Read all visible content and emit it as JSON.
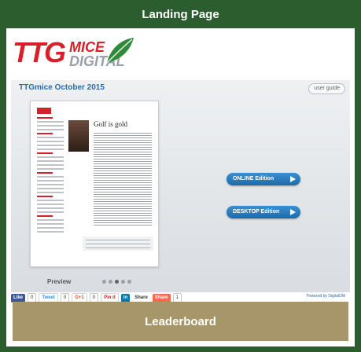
{
  "header": {
    "title": "Landing Page"
  },
  "logo": {
    "ttg": "TTG",
    "mice": "MICE",
    "digital": "DIGITAL"
  },
  "viewer": {
    "title": "TTGmice October 2015",
    "user_guide": "user guide",
    "page": {
      "headline": "Golf is gold"
    },
    "buttons": {
      "online": "ONLINE Edition",
      "desktop": "DESKTOP Edition"
    },
    "preview_label": "Preview",
    "dots_active_index": 2
  },
  "share_bar": {
    "like": "Like",
    "like_count": "0",
    "tweet": "Tweet",
    "tweet_count": "0",
    "gplus": "G+1",
    "gplus_count": "0",
    "pinit": "Pin it",
    "linkedin": "in",
    "linkedin_share": "Share",
    "share": "Share",
    "share_count": "1",
    "powered_by": "Powered by DigitalDM"
  },
  "leaderboard": {
    "label": "Leaderboard"
  },
  "colors": {
    "frame": "#2c5d2e",
    "leaderboard": "#a6966a",
    "accent_blue": "#2c6ba8",
    "brand_red": "#d6202a"
  }
}
